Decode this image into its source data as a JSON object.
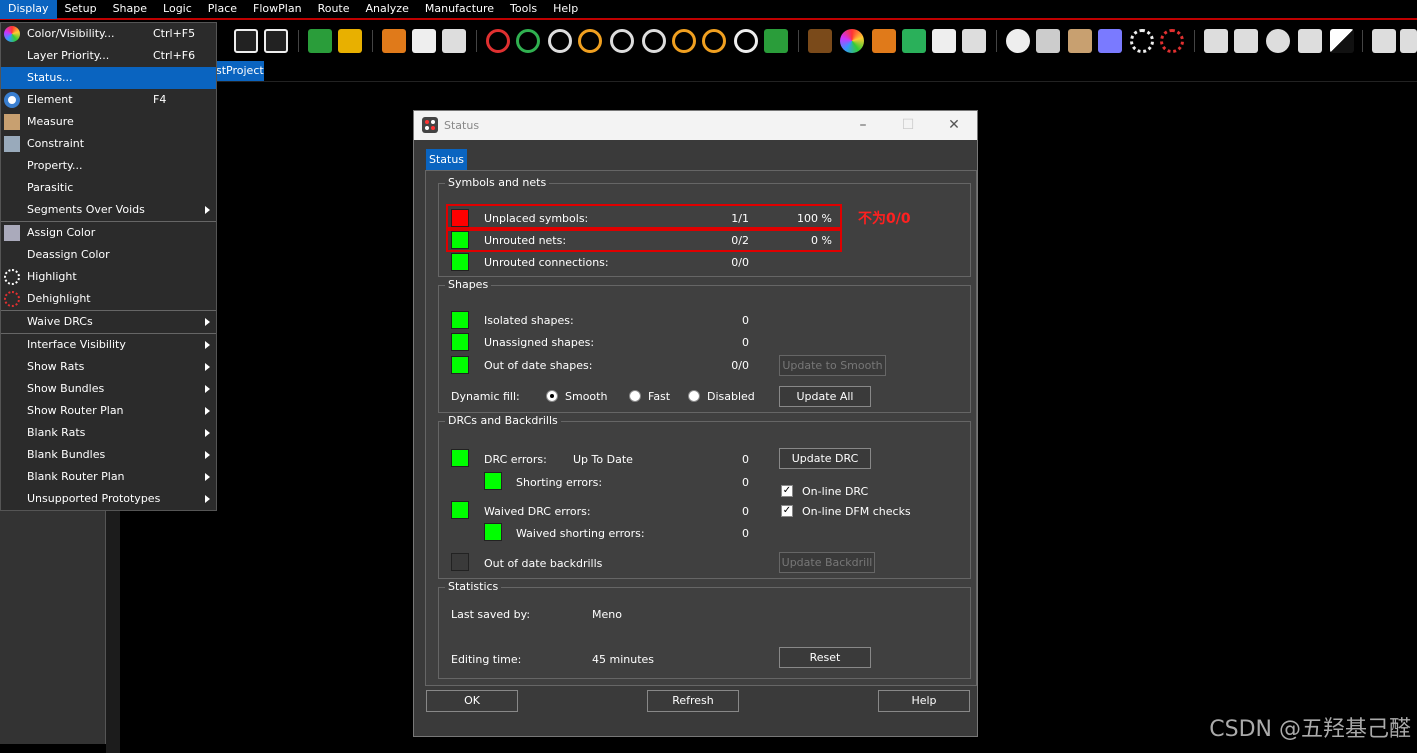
{
  "menubar": [
    "Display",
    "Setup",
    "Shape",
    "Logic",
    "Place",
    "FlowPlan",
    "Route",
    "Analyze",
    "Manufacture",
    "Tools",
    "Help"
  ],
  "doc_tab": "stProject",
  "dropdown": [
    {
      "label": "Color/Visibility...",
      "shortcut": "Ctrl+F5",
      "icon": "color-wheel-icon"
    },
    {
      "label": "Layer Priority...",
      "shortcut": "Ctrl+F6"
    },
    {
      "label": "Status...",
      "highlighted": true
    },
    {
      "label": "Element",
      "shortcut": "F4",
      "icon": "eye-icon"
    },
    {
      "label": "Measure",
      "icon": "measure-icon"
    },
    {
      "label": "Constraint",
      "icon": "constraint-icon"
    },
    {
      "label": "Property..."
    },
    {
      "label": "Parasitic"
    },
    {
      "label": "Segments Over Voids",
      "submenu": true
    },
    {
      "sep": true
    },
    {
      "label": "Assign Color",
      "icon": "assign-color-icon"
    },
    {
      "label": "Deassign Color"
    },
    {
      "label": "Highlight",
      "icon": "highlight-icon"
    },
    {
      "label": "Dehighlight",
      "icon": "dehighlight-icon"
    },
    {
      "sep": true
    },
    {
      "label": "Waive DRCs",
      "submenu": true
    },
    {
      "sep": true
    },
    {
      "label": "Interface Visibility",
      "submenu": true
    },
    {
      "label": "Show Rats",
      "submenu": true
    },
    {
      "label": "Show Bundles",
      "submenu": true
    },
    {
      "label": "Show Router Plan",
      "submenu": true
    },
    {
      "label": "Blank Rats",
      "submenu": true
    },
    {
      "label": "Blank Bundles",
      "submenu": true
    },
    {
      "label": "Blank Router Plan",
      "submenu": true
    },
    {
      "label": "Unsupported Prototypes",
      "submenu": true
    }
  ],
  "dialog": {
    "title": "Status",
    "tab": "Status",
    "symbols": {
      "group_title": "Symbols and nets",
      "unplaced_label": "Unplaced symbols:",
      "unplaced_count": "1/1",
      "unplaced_pct": "100 %",
      "unrouted_nets_label": "Unrouted nets:",
      "unrouted_nets_count": "0/2",
      "unrouted_nets_pct": "0 %",
      "unrouted_conn_label": "Unrouted connections:",
      "unrouted_conn_count": "0/0"
    },
    "shapes": {
      "group_title": "Shapes",
      "isolated_label": "Isolated shapes:",
      "isolated_count": "0",
      "unassigned_label": "Unassigned shapes:",
      "unassigned_count": "0",
      "outofdate_label": "Out of date shapes:",
      "outofdate_count": "0/0",
      "update_smooth": "Update to Smooth",
      "dynamic_fill_label": "Dynamic fill:",
      "fill_options": [
        "Smooth",
        "Fast",
        "Disabled"
      ],
      "update_all": "Update All"
    },
    "drc": {
      "group_title": "DRCs and Backdrills",
      "drc_errors_label": "DRC errors:",
      "drc_state": "Up To Date",
      "drc_count": "0",
      "update_drc": "Update DRC",
      "shorting_label": "Shorting errors:",
      "shorting_count": "0",
      "online_drc": "On-line DRC",
      "online_dfm": "On-line DFM checks",
      "waived_label": "Waived DRC errors:",
      "waived_count": "0",
      "waived_short_label": "Waived shorting errors:",
      "waived_short_count": "0",
      "backdrills_label": "Out of date backdrills",
      "update_backdrill": "Update Backdrill"
    },
    "stats": {
      "group_title": "Statistics",
      "saved_label": "Last saved by:",
      "saved_value": "Meno",
      "editing_label": "Editing time:",
      "editing_value": "45 minutes",
      "reset": "Reset"
    },
    "buttons": {
      "ok": "OK",
      "refresh": "Refresh",
      "help": "Help"
    }
  },
  "annotation": "不为0/0",
  "watermark": "CSDN @五羟基己醛",
  "colors": {
    "ok": "#00ff00",
    "error": "#ff0000",
    "accent": "#0a64c0",
    "highlight_box": "#e00000"
  }
}
